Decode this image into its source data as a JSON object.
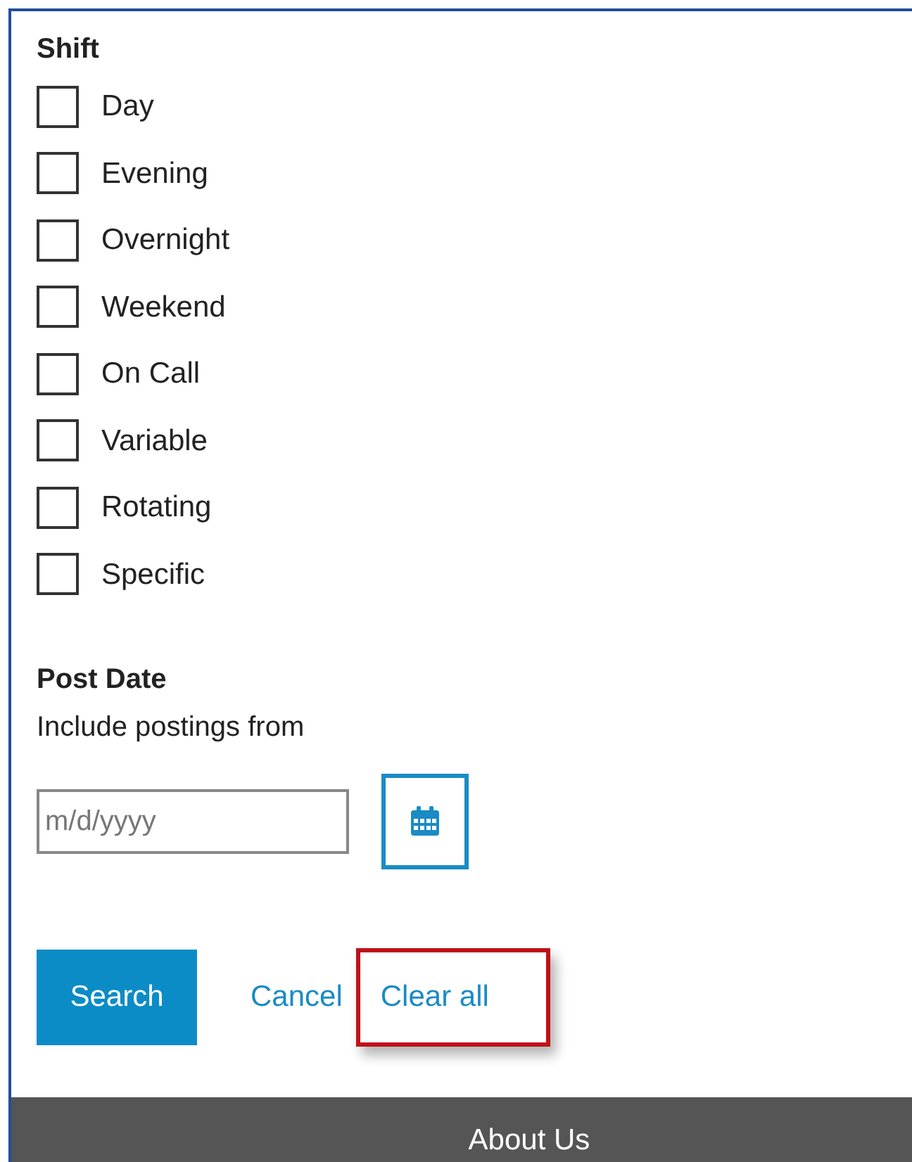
{
  "shift": {
    "title": "Shift",
    "options": [
      {
        "label": "Day",
        "checked": false
      },
      {
        "label": "Evening",
        "checked": false
      },
      {
        "label": "Overnight",
        "checked": false
      },
      {
        "label": "Weekend",
        "checked": false
      },
      {
        "label": "On Call",
        "checked": false
      },
      {
        "label": "Variable",
        "checked": false
      },
      {
        "label": "Rotating",
        "checked": false
      },
      {
        "label": "Specific",
        "checked": false
      }
    ]
  },
  "post_date": {
    "title": "Post Date",
    "hint": "Include postings from",
    "date_field": {
      "placeholder": "m/d/yyyy"
    }
  },
  "actions": [
    {
      "kind": "button",
      "label": "Search",
      "highlighted": false
    },
    {
      "kind": "link",
      "label": "Cancel",
      "highlighted": false
    },
    {
      "kind": "link",
      "label": "Clear all",
      "highlighted": true
    }
  ],
  "footer": {
    "link": "About Us"
  }
}
